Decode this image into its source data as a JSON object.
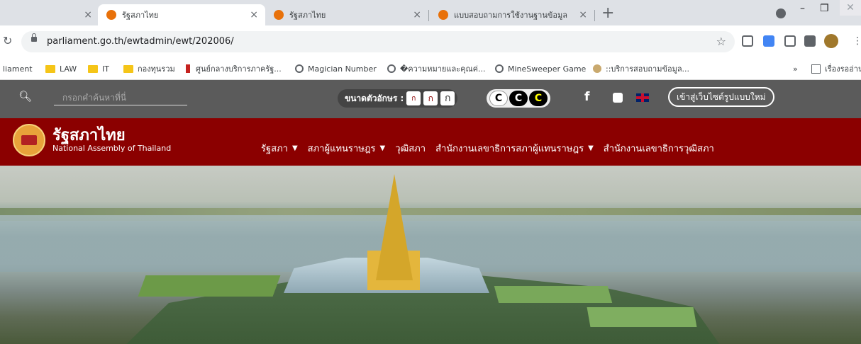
{
  "browser": {
    "tabs": [
      {
        "title": "",
        "active": false
      },
      {
        "title": "รัฐสภาไทย",
        "active": true
      },
      {
        "title": "รัฐสภาไทย",
        "active": false
      },
      {
        "title": "แบบสอบถามการใช้งานฐานข้อมูล",
        "active": false
      }
    ],
    "tab_close": "×",
    "new_tab": "+",
    "window_minimize": "–",
    "window_restore": "❐",
    "window_close": "✕",
    "url": "parliament.go.th/ewtadmin/ewt/202006/",
    "bookmarks": [
      {
        "label": "liament",
        "icon": "none"
      },
      {
        "label": "LAW",
        "icon": "folder"
      },
      {
        "label": "IT",
        "icon": "folder"
      },
      {
        "label": "กองทุนรวม",
        "icon": "folder"
      },
      {
        "label": "ศูนย์กลางบริการภาครัฐ...",
        "icon": "bookmark-red"
      },
      {
        "label": "Magician Number",
        "icon": "globe"
      },
      {
        "label": "�ความหมายและคุณค่...",
        "icon": "globe"
      },
      {
        "label": "MineSweeper Game",
        "icon": "globe"
      },
      {
        "label": "::บริการสอบถามข้อมูล...",
        "icon": "site"
      }
    ],
    "bookmarks_overflow": "»",
    "reading_list": "เรื่องรออ่าน"
  },
  "site": {
    "search_placeholder": "กรอกคำค้นหาที่นี่",
    "font_size_label": "ขนาดตัวอักษร :",
    "font_size_buttons": [
      "ก",
      "ก",
      "ก"
    ],
    "contrast_buttons": [
      "C",
      "C",
      "C"
    ],
    "facebook": "f",
    "new_site_button": "เข้าสู่เว็บไซต์รูปแบบใหม่",
    "brand_th": "รัฐสภาไทย",
    "brand_en": "National Assembly of Thailand",
    "menu": [
      {
        "label": "รัฐสภา",
        "dropdown": true
      },
      {
        "label": "สภาผู้แทนราษฎร",
        "dropdown": true
      },
      {
        "label": "วุฒิสภา",
        "dropdown": false
      },
      {
        "label": "สำนักงานเลขาธิการสภาผู้แทนราษฎร",
        "dropdown": true
      },
      {
        "label": "สำนักงานเลขาธิการวุฒิสภา",
        "dropdown": false
      }
    ],
    "chevron": "⌄"
  },
  "colors": {
    "navbar": "#8b0000",
    "topbar": "#5b5b5b"
  }
}
